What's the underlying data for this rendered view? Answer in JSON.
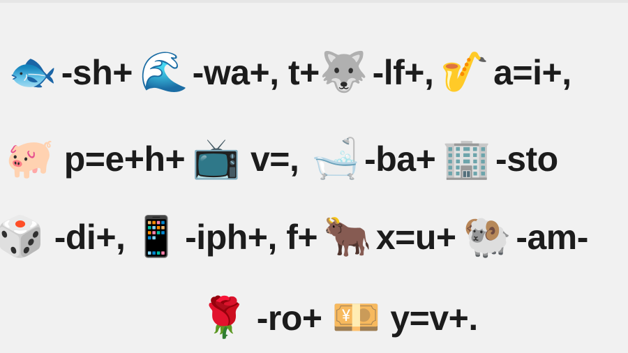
{
  "rebus": {
    "line1": [
      {
        "type": "icon",
        "icon": "fish-icon",
        "glyph": "🐟"
      },
      {
        "type": "text",
        "text": "-sh+"
      },
      {
        "type": "icon",
        "icon": "wave-icon",
        "glyph": "🌊"
      },
      {
        "type": "text",
        "text": "-wa+, t+"
      },
      {
        "type": "icon",
        "icon": "wolf-icon",
        "glyph": "🐺"
      },
      {
        "type": "text",
        "text": "-lf+,"
      },
      {
        "type": "icon",
        "icon": "saxophone-icon",
        "glyph": "🎷"
      },
      {
        "type": "text",
        "text": "a=i+,"
      }
    ],
    "line2": [
      {
        "type": "icon",
        "icon": "pig-icon",
        "glyph": "🐖"
      },
      {
        "type": "text",
        "text": "p=e+h+"
      },
      {
        "type": "icon",
        "icon": "television-icon",
        "glyph": "📺"
      },
      {
        "type": "text",
        "text": "v=,"
      },
      {
        "type": "icon",
        "icon": "bathtub-icon",
        "glyph": "🛁"
      },
      {
        "type": "text",
        "text": "-ba+"
      },
      {
        "type": "icon",
        "icon": "building-icon",
        "glyph": "🏢"
      },
      {
        "type": "text",
        "text": "-sto"
      }
    ],
    "line3": [
      {
        "type": "icon",
        "icon": "dice-icon",
        "glyph": "🎲"
      },
      {
        "type": "text",
        "text": "-di+,"
      },
      {
        "type": "icon",
        "icon": "mobile-phone-icon",
        "glyph": "📱"
      },
      {
        "type": "text",
        "text": "-iph+, f+"
      },
      {
        "type": "icon",
        "icon": "ox-icon",
        "glyph": "🐂"
      },
      {
        "type": "text",
        "text": "x=u+"
      },
      {
        "type": "icon",
        "icon": "ram-icon",
        "glyph": "🐏"
      },
      {
        "type": "text",
        "text": "-am-"
      }
    ],
    "line4": [
      {
        "type": "icon",
        "icon": "rose-icon",
        "glyph": "🌹"
      },
      {
        "type": "text",
        "text": "-ro+"
      },
      {
        "type": "icon",
        "icon": "yen-banknote-icon",
        "glyph": "💴"
      },
      {
        "type": "text",
        "text": "y=v+."
      }
    ]
  }
}
